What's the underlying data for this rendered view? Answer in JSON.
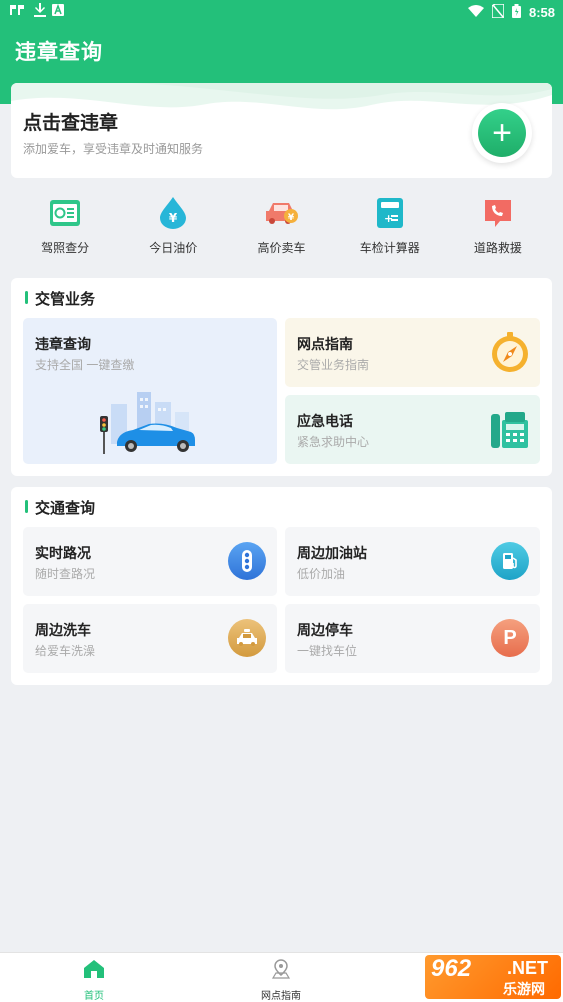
{
  "status_bar": {
    "time": "8:58"
  },
  "header": {
    "title": "违章查询"
  },
  "hero": {
    "title": "点击查违章",
    "subtitle": "添加爱车，享受违章及时通知服务",
    "add_symbol": "+"
  },
  "quick_actions": [
    {
      "label": "驾照查分",
      "icon": "license-icon"
    },
    {
      "label": "今日油价",
      "icon": "oil-drop-icon"
    },
    {
      "label": "高价卖车",
      "icon": "sell-car-icon"
    },
    {
      "label": "车检计算器",
      "icon": "calculator-icon"
    },
    {
      "label": "道路救援",
      "icon": "rescue-phone-icon"
    }
  ],
  "traffic_business": {
    "title": "交管业务",
    "violation": {
      "title": "违章查询",
      "subtitle": "支持全国 一键查缴"
    },
    "guide": {
      "title": "网点指南",
      "subtitle": "交管业务指南"
    },
    "emergency": {
      "title": "应急电话",
      "subtitle": "紧急求助中心"
    }
  },
  "traffic_query": {
    "title": "交通查询",
    "items": [
      {
        "title": "实时路况",
        "subtitle": "随时查路况",
        "icon": "traffic-light-icon",
        "color": "#3d86e6"
      },
      {
        "title": "周边加油站",
        "subtitle": "低价加油",
        "icon": "gas-pump-icon",
        "color": "#2bb4d4"
      },
      {
        "title": "周边洗车",
        "subtitle": "给爱车洗澡",
        "icon": "car-wash-icon",
        "color": "#d9a34a"
      },
      {
        "title": "周边停车",
        "subtitle": "一键找车位",
        "icon": "parking-icon",
        "color": "#ef7a55",
        "glyph": "P"
      }
    ]
  },
  "bottom_nav": {
    "home": "首页",
    "guide": "网点指南"
  },
  "watermark": {
    "number": "962",
    "net": ".NET",
    "cn": "乐游网"
  },
  "colors": {
    "brand": "#23c07a",
    "page_bg": "#eef0f3"
  }
}
